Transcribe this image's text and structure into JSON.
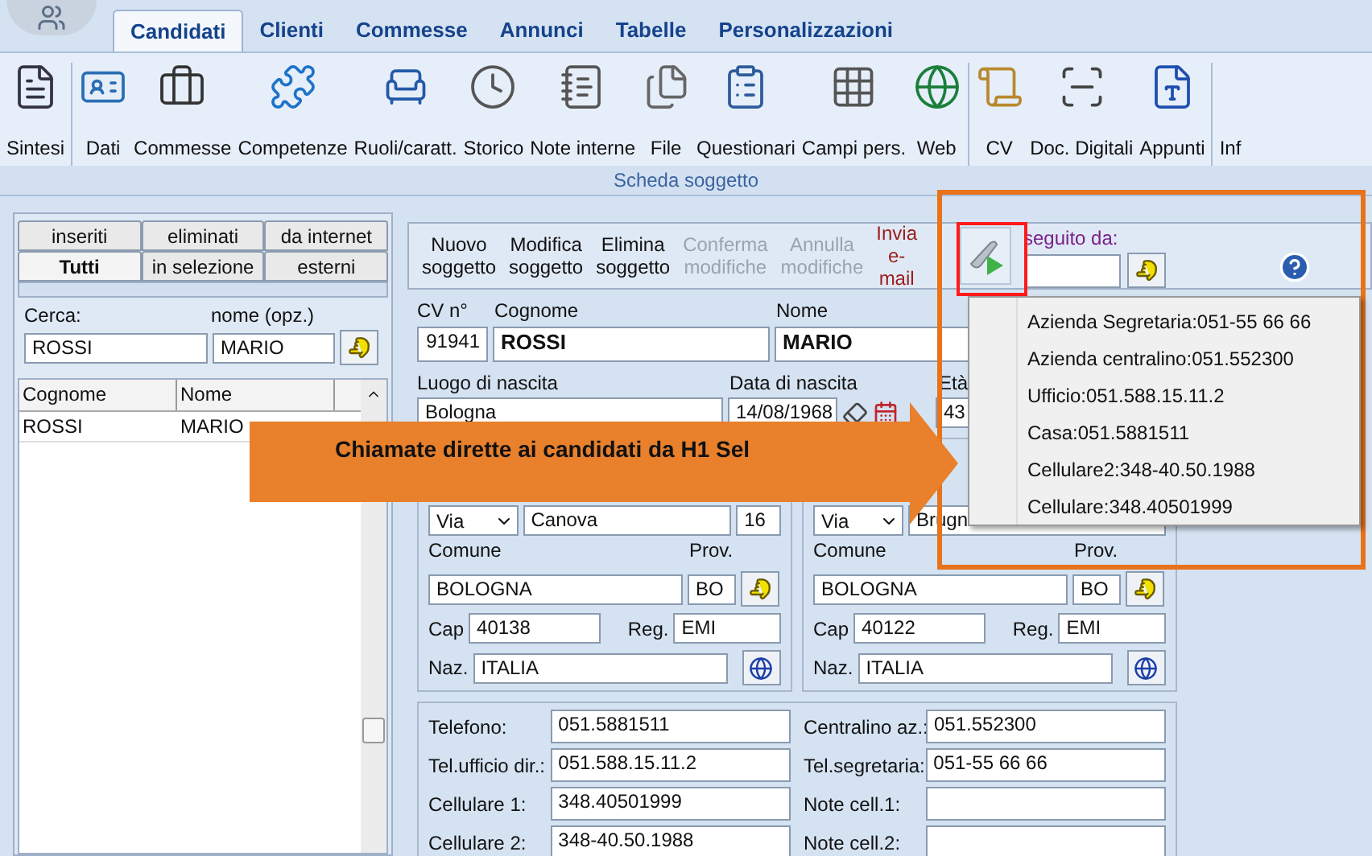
{
  "app_tabs": [
    {
      "label": "Candidati",
      "selected": true
    },
    {
      "label": "Clienti",
      "selected": false
    },
    {
      "label": "Commesse",
      "selected": false
    },
    {
      "label": "Annunci",
      "selected": false
    },
    {
      "label": "Tabelle",
      "selected": false
    },
    {
      "label": "Personalizzazioni",
      "selected": false
    }
  ],
  "ribbon": {
    "groups": [
      [
        {
          "label": "Sintesi"
        }
      ],
      [
        {
          "label": "Dati"
        },
        {
          "label": "Commesse"
        },
        {
          "label": "Competenze"
        },
        {
          "label": "Ruoli/caratt."
        },
        {
          "label": "Storico"
        },
        {
          "label": "Note interne"
        },
        {
          "label": "File"
        },
        {
          "label": "Questionari"
        },
        {
          "label": "Campi pers."
        },
        {
          "label": "Web"
        }
      ],
      [
        {
          "label": "CV"
        },
        {
          "label": "Doc. Digitali"
        },
        {
          "label": "Appunti"
        }
      ],
      [
        {
          "label": "Inf"
        }
      ]
    ],
    "group_label": "Scheda soggetto"
  },
  "left_panel": {
    "tab_rows": [
      [
        {
          "label": "inseriti",
          "selected": false
        },
        {
          "label": "eliminati",
          "selected": false
        },
        {
          "label": "da internet",
          "selected": false
        }
      ],
      [
        {
          "label": "Tutti",
          "selected": true
        },
        {
          "label": "in selezione",
          "selected": false
        },
        {
          "label": "esterni",
          "selected": false
        }
      ]
    ],
    "search": {
      "label": "Cerca:",
      "value": "ROSSI",
      "name_label": "nome (opz.)",
      "name_value": "MARIO"
    },
    "list": {
      "columns": [
        "Cognome",
        "Nome"
      ],
      "rows": [
        [
          "ROSSI",
          "MARIO"
        ]
      ]
    }
  },
  "toolbar": {
    "buttons": [
      {
        "label": "Nuovo soggetto",
        "disabled": false,
        "kind": "normal"
      },
      {
        "label": "Modifica soggetto",
        "disabled": false,
        "kind": "normal"
      },
      {
        "label": "Elimina soggetto",
        "disabled": false,
        "kind": "normal"
      },
      {
        "label": "Conferma modifiche",
        "disabled": true,
        "kind": "normal"
      },
      {
        "label": "Annulla modifiche",
        "disabled": true,
        "kind": "normal"
      },
      {
        "label": "Invia e-mail",
        "disabled": false,
        "kind": "email"
      }
    ],
    "followed_by": {
      "label": "seguito da:"
    }
  },
  "form": {
    "cv": {
      "label": "CV n°",
      "value": "91941"
    },
    "surname": {
      "label": "Cognome",
      "value": "ROSSI"
    },
    "name": {
      "label": "Nome",
      "value": "MARIO"
    },
    "birthplace": {
      "label": "Luogo di nascita",
      "value": "Bologna"
    },
    "birthdate": {
      "label": "Data di nascita",
      "value": "14/08/1968"
    },
    "age": {
      "label": "Età",
      "value": "43"
    },
    "addresses": [
      {
        "street_type": "Via",
        "street": "Canova",
        "number": "16",
        "city_label": "Comune",
        "prov_label": "Prov.",
        "city": "BOLOGNA",
        "prov": "BO",
        "cap_label": "Cap",
        "cap": "40138",
        "reg_label": "Reg.",
        "reg": "EMI",
        "country_label": "Naz.",
        "country": "ITALIA"
      },
      {
        "street_type": "Via",
        "street": "Brugn",
        "city_label": "Comune",
        "prov_label": "Prov.",
        "city": "BOLOGNA",
        "prov": "BO",
        "cap_label": "Cap",
        "cap": "40122",
        "reg_label": "Reg.",
        "reg": "EMI",
        "country_label": "Naz.",
        "country": "ITALIA"
      }
    ],
    "contacts": [
      {
        "label": "Telefono:",
        "value": "051.5881511"
      },
      {
        "label": "Centralino az.:",
        "value": "051.552300"
      },
      {
        "label": "Tel.ufficio dir.:",
        "value": "051.588.15.11.2"
      },
      {
        "label": "Tel.segretaria:",
        "value": "051-55 66 66"
      },
      {
        "label": "Cellulare 1:",
        "value": "348.40501999"
      },
      {
        "label": "Note cell.1:"
      },
      {
        "label": "Cellulare 2:",
        "value": "348-40.50.1988"
      },
      {
        "label": "Note cell.2:"
      }
    ]
  },
  "call_menu": {
    "items": [
      "Azienda Segretaria:051-55 66 66",
      "Azienda centralino:051.552300",
      "Ufficio:051.588.15.11.2",
      "Casa:051.5881511",
      "Cellulare2:348-40.50.1988",
      "Cellulare:348.40501999"
    ]
  },
  "callout": {
    "text": "Chiamate dirette ai candidati da H1 Sel"
  }
}
